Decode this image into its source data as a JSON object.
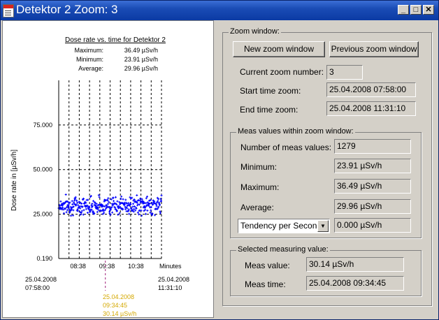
{
  "window": {
    "title": "Detektor 2 Zoom: 3",
    "minimize_label": "_",
    "maximize_label": "□",
    "close_label": "✕"
  },
  "chart": {
    "title": "Dose rate vs. time for Detektor 2",
    "stats": [
      {
        "label": "Maximum:",
        "value": "36.49 µSv/h"
      },
      {
        "label": "Minimum:",
        "value": "23.91 µSv/h"
      },
      {
        "label": "Average:",
        "value": "29.96 µSv/h"
      }
    ],
    "ylabel": "Dose rate in  [µSv/h]",
    "xunit_label": "Minutes",
    "start_date": "25.04.2008",
    "start_time": "07:58:00",
    "end_date": "25.04.2008",
    "end_time": "11:31:10",
    "cursor_date": "25.04.2008",
    "cursor_time": "09:34:45",
    "cursor_value": "30.14 µSv/h",
    "cursor_color": "#d4a800",
    "series_color": "#0000ff"
  },
  "chart_data": {
    "type": "scatter",
    "title": "Dose rate vs. time for Detektor 2",
    "xlabel": "Minutes",
    "ylabel": "Dose rate in  [µSv/h]",
    "yticks": [
      "0.190",
      "25.000",
      "50.000",
      "75.000"
    ],
    "ytick_values": [
      0.19,
      25,
      50,
      75
    ],
    "ylim": [
      0.19,
      100
    ],
    "xticks": [
      "08:38",
      "09:38",
      "10:38"
    ],
    "xtick_minutes": [
      40,
      100,
      160
    ],
    "xlim_minutes": [
      0,
      213.17
    ],
    "cursor_minutes": 96.75,
    "series": [
      {
        "values_min": 23.91,
        "values_max": 36.49,
        "average": 29.96,
        "count": 1279
      }
    ],
    "grid": "vertical dashed"
  },
  "zoom": {
    "group_label": "Zoom window:",
    "new_button": "New zoom window",
    "prev_button": "Previous zoom window",
    "current_label": "Current zoom number:",
    "current_value": "3",
    "start_label": "Start time zoom:",
    "start_value": "25.04.2008  07:58:00",
    "end_label": "End time zoom:",
    "end_value": "25.04.2008  11:31:10"
  },
  "meas": {
    "group_label": "Meas values within zoom window:",
    "count_label": "Number of meas values:",
    "count_value": "1279",
    "min_label": "Minimum:",
    "min_value": "23.91 µSv/h",
    "max_label": "Maximum:",
    "max_value": "36.49 µSv/h",
    "avg_label": "Average:",
    "avg_value": "29.96 µSv/h",
    "tendency_select": "Tendency per Second",
    "tendency_value": "0.000 µSv/h"
  },
  "selected": {
    "group_label": "Selected measuring value:",
    "value_label": "Meas value:",
    "value": "30.14 µSv/h",
    "time_label": "Meas time:",
    "time": "25.04.2008 09:34:45"
  }
}
